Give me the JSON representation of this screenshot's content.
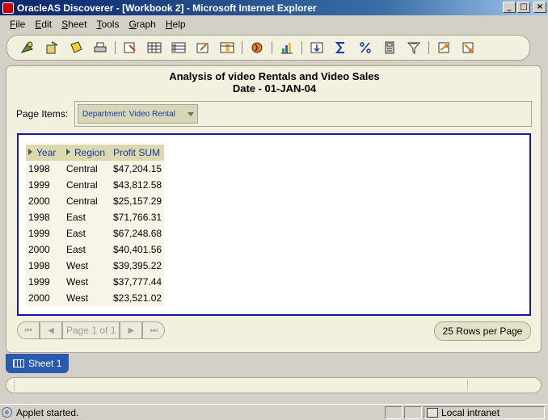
{
  "window": {
    "title": "OracleAS Discoverer - [Workbook 2] - Microsoft Internet Explorer",
    "controls": {
      "minimize": "_",
      "maximize": "□",
      "close": "×"
    }
  },
  "menu": [
    {
      "label": "File",
      "icon": ""
    },
    {
      "label": "Edit"
    },
    {
      "label": "Sheet"
    },
    {
      "label": "Tools"
    },
    {
      "label": "Graph"
    },
    {
      "label": "Help"
    }
  ],
  "toolbar": {
    "icons": [
      "open-workbook-icon",
      "new-workbook-icon",
      "save-icon",
      "print-icon",
      "edit-sheet-icon",
      "table-layout-icon",
      "crosstab-layout-icon",
      "export-icon",
      "drill-icon",
      "graph-icon",
      "sort-icon",
      "sum-icon",
      "percentage-icon",
      "calculation-icon",
      "filter-icon",
      "rank-icon",
      "exception-icon"
    ]
  },
  "report": {
    "title_line1": "Analysis of video Rentals and Video Sales",
    "title_line2": "Date - 01-JAN-04"
  },
  "page_items": {
    "label": "Page Items:",
    "department": "Department:  Video Rental"
  },
  "table": {
    "headers": [
      "Year",
      "Region",
      "Profit SUM"
    ],
    "rows": [
      [
        "1998",
        "Central",
        "$47,204.15"
      ],
      [
        "1999",
        "Central",
        "$43,812.58"
      ],
      [
        "2000",
        "Central",
        "$25,157.29"
      ],
      [
        "1998",
        "East",
        "$71,766.31"
      ],
      [
        "1999",
        "East",
        "$67,248.68"
      ],
      [
        "2000",
        "East",
        "$40,401.56"
      ],
      [
        "1998",
        "West",
        "$39,395.22"
      ],
      [
        "1999",
        "West",
        "$37,777.44"
      ],
      [
        "2000",
        "West",
        "$23,521.02"
      ]
    ]
  },
  "pager": {
    "page_text": "Page 1 of 1",
    "rows_per_page": "25 Rows per Page"
  },
  "sheet_tab": {
    "label": "Sheet 1"
  },
  "status": {
    "text": "Applet started.",
    "zone": "Local intranet"
  }
}
